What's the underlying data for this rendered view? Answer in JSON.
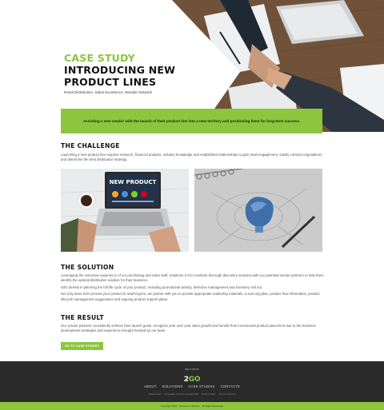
{
  "hero": {
    "eyebrow": "CASE STUDY",
    "title": "INTRODUCING NEW PRODUCT LINES",
    "subtitle": "Retail Distribution, Sales Excellence, Retailer Network",
    "banner": "Assisting a new vendor with the launch of their product line into a new territory and positioning them for long-term success."
  },
  "challenge": {
    "heading": "THE CHALLENGE",
    "body": "Launching a new product line requires research, financial analysis, industry knowledge and established relationships to gain retail engagement, satisfy contract negotiations and determine the best distribution strategy."
  },
  "images": {
    "left_screen_text": "NEW PRODUCT"
  },
  "solution": {
    "heading": "THE SOLUTION",
    "p1": "Leveraging the extensive experience of our purchasing and sales staff, Solutions 2-GO conducts thorough discovery sessions with our potential vendor partners to help them identify the optimal distribution solution for their business.",
    "p2": "S2G assists in planning the full life cycle of your product, including promotional activity, defective management and inventory sell out.",
    "p3": "Not only does S2G present your product to retail buyers, we partner with you to provide appropriate marketing materials, a sourcing plan, product flow information, product lifecycle management suggestions and ongoing product support plans."
  },
  "result": {
    "heading": "THE RESULT",
    "body": "Our vendor partners consistently achieve their launch goals, recognize year over year sales growth and benefit from incremental product placement due to the business development strategies and experience brought forward by our team.",
    "cta": "GO TO CASE STUDIES"
  },
  "footer": {
    "logo_small": "SOLUTIONS",
    "logo_a": "2",
    "logo_b": "GO",
    "nav": [
      "ABOUT",
      "SOLUTIONS",
      "CASE STUDIES",
      "CONTACTS"
    ],
    "links": [
      "Global Index",
      "Accessible Customer Service Plan",
      "Privacy Policy",
      "Terms of Service"
    ],
    "copyright": "Copyright 2024 · Solutions 2-GO Inc. · All Rights Reserved"
  },
  "colors": {
    "accent": "#8cc63f",
    "footer": "#2a2a2a"
  }
}
